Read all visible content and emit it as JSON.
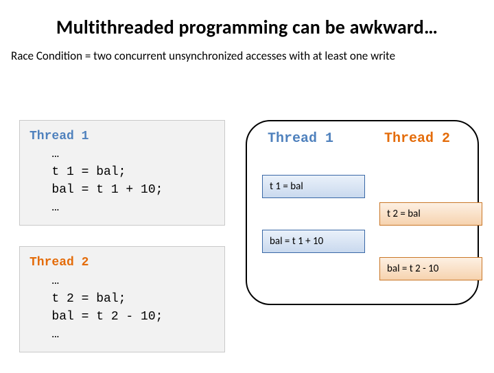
{
  "title": "Multithreaded programming can be awkward…",
  "subtitle": "Race Condition = two concurrent unsynchronized accesses with at least one write",
  "code1": {
    "head": "Thread 1",
    "body": "   …\n   t 1 = bal;\n   bal = t 1 + 10;\n   …"
  },
  "code2": {
    "head": "Thread 2",
    "body": "   …\n   t 2 = bal;\n   bal = t 2 - 10;\n   …"
  },
  "panel": {
    "head1": "Thread 1",
    "head2": "Thread 2",
    "chip1": "t 1 = bal",
    "chip2": "t 2 = bal",
    "chip3": "bal = t 1 + 10",
    "chip4": "bal = t 2 - 10"
  }
}
